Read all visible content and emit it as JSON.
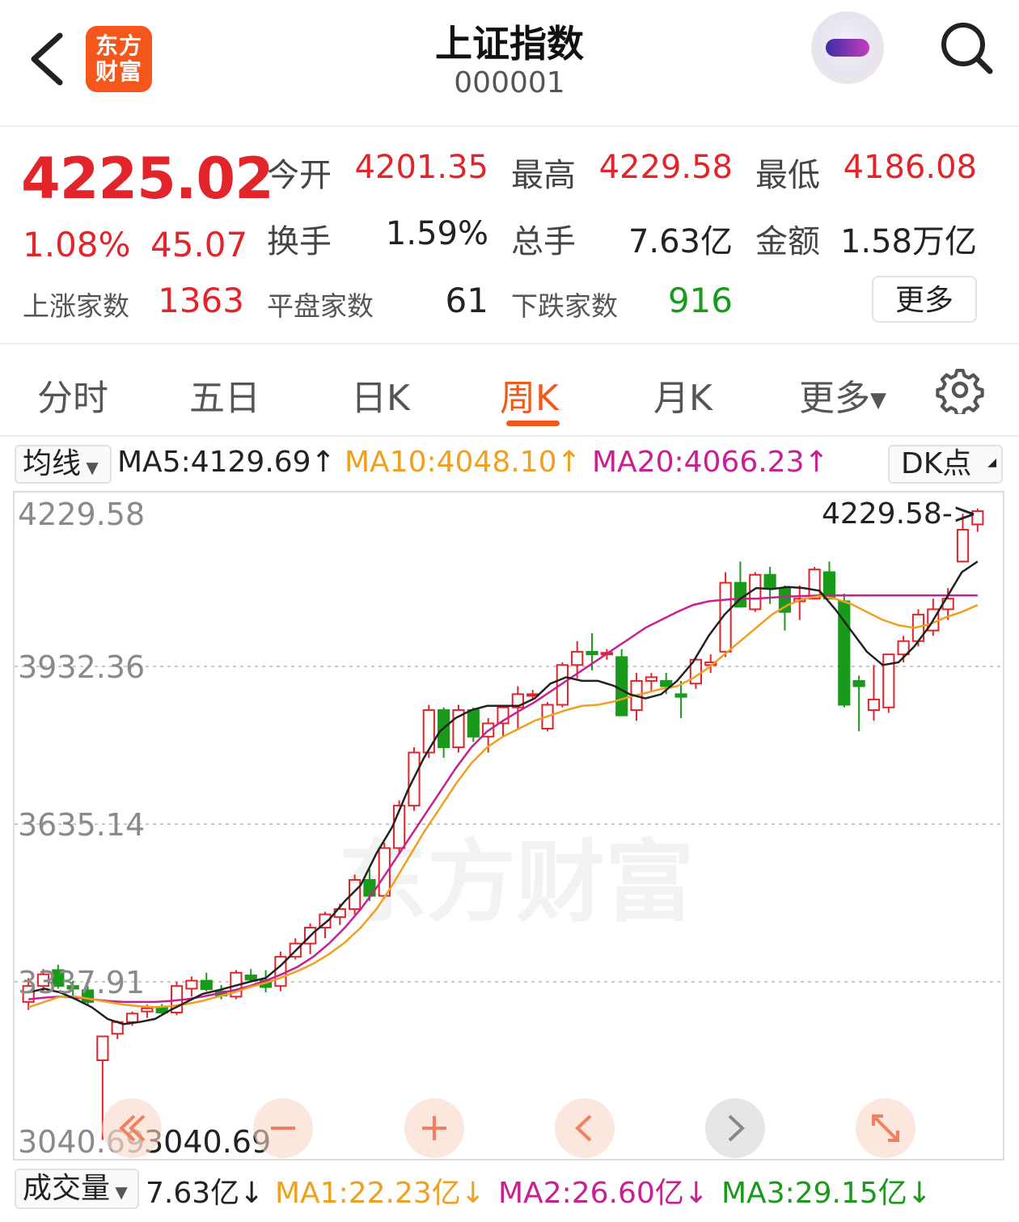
{
  "header": {
    "logo_line1": "东方",
    "logo_line2": "财富",
    "title": "上证指数",
    "code": "000001"
  },
  "quote": {
    "price": "4225.02",
    "change_pct": "1.08%",
    "change_abs": "45.07",
    "open_label": "今开",
    "open": "4201.35",
    "high_label": "最高",
    "high": "4229.58",
    "low_label": "最低",
    "low": "4186.08",
    "turnover_label": "换手",
    "turnover": "1.59%",
    "volume_label": "总手",
    "volume": "7.63亿",
    "amount_label": "金额",
    "amount": "1.58万亿",
    "up_label": "上涨家数",
    "up": "1363",
    "flat_label": "平盘家数",
    "flat": "61",
    "down_label": "下跌家数",
    "down": "916",
    "more": "更多"
  },
  "tabs": [
    "分时",
    "五日",
    "日K",
    "周K",
    "月K",
    "更多"
  ],
  "active_tab": "周K",
  "ma_bar": {
    "selector": "均线",
    "ma5": "MA5:4129.69↑",
    "ma10": "MA10:4048.10↑",
    "ma20": "MA20:4066.23↑",
    "dk": "DK点"
  },
  "volume_bar": {
    "selector": "成交量",
    "vol": "7.63亿↓",
    "ma1": "MA1:22.23亿↓",
    "ma2": "MA2:26.60亿↓",
    "ma3": "MA3:29.15亿↓"
  },
  "colors": {
    "up": "#e1252b",
    "down": "#1a9a1a",
    "ma5": "#222222",
    "ma10": "#f0a020",
    "ma20": "#c82090",
    "accent": "#ef5a1d"
  },
  "nav_icons": [
    "double-left-icon",
    "zoom-out-icon",
    "zoom-in-icon",
    "left-icon",
    "right-icon",
    "fullscreen-icon"
  ],
  "chart_data": {
    "type": "candlestick",
    "ylim": [
      3040.69,
      4229.58
    ],
    "y_ticks": [
      "4229.58",
      "3932.36",
      "3635.14",
      "3337.91",
      "3040.69"
    ],
    "max_label": "4229.58->",
    "min_label": "3040.69",
    "watermark": "东方财富",
    "candles": [
      [
        3300,
        3345,
        3285,
        3330
      ],
      [
        3330,
        3362,
        3320,
        3352
      ],
      [
        3360,
        3370,
        3325,
        3330
      ],
      [
        3330,
        3340,
        3310,
        3325
      ],
      [
        3322,
        3330,
        3295,
        3300
      ],
      [
        3190,
        3235,
        3040,
        3235
      ],
      [
        3240,
        3265,
        3230,
        3262
      ],
      [
        3262,
        3282,
        3255,
        3278
      ],
      [
        3282,
        3295,
        3270,
        3288
      ],
      [
        3290,
        3296,
        3275,
        3280
      ],
      [
        3280,
        3338,
        3275,
        3330
      ],
      [
        3325,
        3348,
        3310,
        3340
      ],
      [
        3340,
        3355,
        3320,
        3324
      ],
      [
        3320,
        3332,
        3305,
        3312
      ],
      [
        3310,
        3360,
        3305,
        3355
      ],
      [
        3350,
        3362,
        3340,
        3342
      ],
      [
        3340,
        3360,
        3318,
        3328
      ],
      [
        3330,
        3395,
        3320,
        3385
      ],
      [
        3385,
        3420,
        3380,
        3410
      ],
      [
        3410,
        3448,
        3390,
        3440
      ],
      [
        3440,
        3470,
        3420,
        3465
      ],
      [
        3460,
        3485,
        3445,
        3475
      ],
      [
        3475,
        3540,
        3465,
        3530
      ],
      [
        3530,
        3550,
        3490,
        3500
      ],
      [
        3500,
        3600,
        3495,
        3590
      ],
      [
        3590,
        3680,
        3580,
        3670
      ],
      [
        3670,
        3780,
        3660,
        3770
      ],
      [
        3770,
        3860,
        3760,
        3850
      ],
      [
        3850,
        3855,
        3760,
        3780
      ],
      [
        3780,
        3860,
        3770,
        3850
      ],
      [
        3850,
        3855,
        3790,
        3800
      ],
      [
        3800,
        3835,
        3770,
        3825
      ],
      [
        3825,
        3860,
        3800,
        3855
      ],
      [
        3855,
        3895,
        3815,
        3880
      ],
      [
        3880,
        3888,
        3870,
        3880
      ],
      [
        3815,
        3865,
        3810,
        3860
      ],
      [
        3860,
        3940,
        3855,
        3935
      ],
      [
        3935,
        3980,
        3910,
        3960
      ],
      [
        3960,
        3995,
        3925,
        3955
      ],
      [
        3955,
        3965,
        3945,
        3958
      ],
      [
        3950,
        3965,
        3840,
        3840
      ],
      [
        3850,
        3920,
        3830,
        3905
      ],
      [
        3905,
        3920,
        3885,
        3912
      ],
      [
        3905,
        3920,
        3880,
        3895
      ],
      [
        3880,
        3905,
        3835,
        3875
      ],
      [
        3900,
        3950,
        3890,
        3945
      ],
      [
        3935,
        3955,
        3920,
        3940
      ],
      [
        3960,
        4110,
        3950,
        4090
      ],
      [
        4090,
        4130,
        4045,
        4045
      ],
      [
        4040,
        4110,
        4035,
        4105
      ],
      [
        4105,
        4120,
        4050,
        4080
      ],
      [
        4080,
        4085,
        4000,
        4035
      ],
      [
        4055,
        4085,
        4020,
        4060
      ],
      [
        4060,
        4120,
        4060,
        4115
      ],
      [
        4110,
        4130,
        4090,
        4060
      ],
      [
        4055,
        4070,
        3855,
        3860
      ],
      [
        3905,
        3915,
        3810,
        3895
      ],
      [
        3850,
        3935,
        3830,
        3870
      ],
      [
        3855,
        3955,
        3845,
        3955
      ],
      [
        3955,
        3990,
        3940,
        3980
      ],
      [
        3980,
        4040,
        3970,
        4030
      ],
      [
        4000,
        4060,
        3990,
        4040
      ],
      [
        4040,
        4080,
        4020,
        4060
      ],
      [
        4130,
        4220,
        4130,
        4190
      ],
      [
        4200,
        4230,
        4186,
        4225
      ]
    ],
    "ma5": [
      3318,
      3325,
      3318,
      3305,
      3290,
      3268,
      3258,
      3262,
      3268,
      3285,
      3300,
      3315,
      3322,
      3330,
      3338,
      3345,
      3370,
      3400,
      3430,
      3455,
      3490,
      3520,
      3580,
      3630,
      3700,
      3760,
      3810,
      3835,
      3850,
      3858,
      3858,
      3858,
      3872,
      3900,
      3912,
      3905,
      3905,
      3896,
      3880,
      3872,
      3880,
      3905,
      3940,
      3990,
      4030,
      4060,
      4080,
      4078,
      4082,
      4080,
      4075,
      4040,
      4000,
      3960,
      3935,
      3940,
      3970,
      4010,
      4060,
      4110,
      4130
    ],
    "ma10": [
      3290,
      3300,
      3310,
      3310,
      3305,
      3300,
      3295,
      3292,
      3290,
      3292,
      3296,
      3302,
      3310,
      3318,
      3328,
      3336,
      3346,
      3358,
      3372,
      3390,
      3412,
      3440,
      3475,
      3520,
      3570,
      3620,
      3665,
      3710,
      3750,
      3780,
      3800,
      3815,
      3830,
      3840,
      3850,
      3858,
      3860,
      3866,
      3875,
      3882,
      3890,
      3895,
      3910,
      3930,
      3955,
      3980,
      4005,
      4030,
      4048,
      4060,
      4065,
      4060,
      4050,
      4035,
      4020,
      4010,
      4005,
      4012,
      4025,
      4035,
      4048
    ],
    "ma20": [
      3305,
      3308,
      3310,
      3308,
      3305,
      3302,
      3300,
      3300,
      3300,
      3302,
      3305,
      3310,
      3316,
      3322,
      3330,
      3340,
      3352,
      3366,
      3385,
      3410,
      3440,
      3475,
      3515,
      3560,
      3605,
      3650,
      3695,
      3740,
      3780,
      3810,
      3830,
      3848,
      3865,
      3885,
      3905,
      3925,
      3945,
      3965,
      3985,
      4005,
      4020,
      4035,
      4048,
      4055,
      4058,
      4060,
      4060,
      4062,
      4064,
      4065,
      4066,
      4066,
      4066,
      4066,
      4066,
      4066,
      4066,
      4066,
      4066,
      4066,
      4066
    ]
  }
}
